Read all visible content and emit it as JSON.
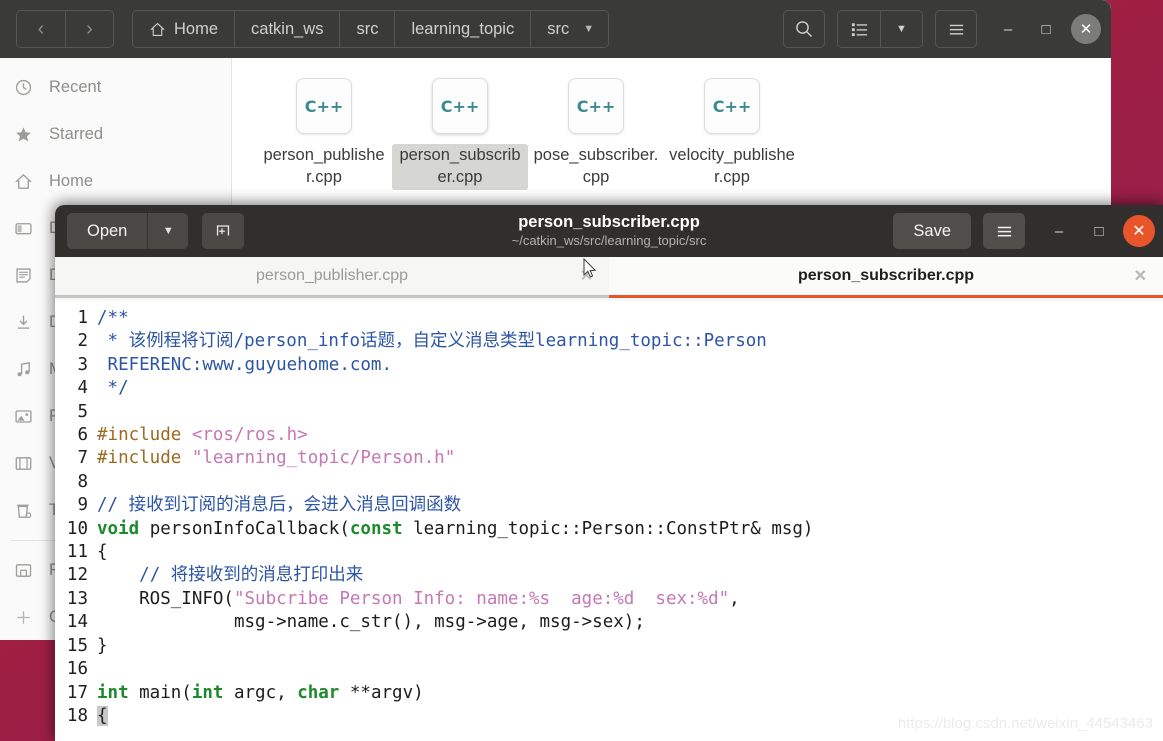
{
  "file_manager": {
    "nav": {
      "back_label": "‹",
      "forward_label": "›"
    },
    "breadcrumbs": [
      {
        "label": "Home",
        "icon": "home-icon"
      },
      {
        "label": "catkin_ws",
        "icon": ""
      },
      {
        "label": "src",
        "icon": ""
      },
      {
        "label": "learning_topic",
        "icon": ""
      },
      {
        "label": "src",
        "icon": ""
      }
    ],
    "toolbar": {
      "search_icon": "search-icon",
      "view_list_icon": "list-view-icon",
      "view_caret_icon": "chevron-down-icon",
      "menu_icon": "hamburger-menu-icon",
      "minimize_label": "–",
      "maximize_label": "□",
      "close_label": "✕"
    },
    "places": [
      {
        "label": "Recent",
        "icon": "clock-icon"
      },
      {
        "label": "Starred",
        "icon": "star-icon"
      },
      {
        "label": "Home",
        "icon": "home-icon"
      },
      {
        "label": "Desktop",
        "icon": "desktop-icon"
      },
      {
        "label": "Documents",
        "icon": "documents-icon"
      },
      {
        "label": "Downloads",
        "icon": "downloads-icon"
      },
      {
        "label": "Music",
        "icon": "music-icon"
      },
      {
        "label": "Pictures",
        "icon": "pictures-icon"
      },
      {
        "label": "Videos",
        "icon": "videos-icon"
      },
      {
        "label": "Trash",
        "icon": "trash-icon"
      },
      {
        "label": "Floppy Disk",
        "icon": "floppy-icon"
      },
      {
        "label": "Other Locations",
        "icon": "plus-icon"
      }
    ],
    "files": [
      {
        "name": "person_publisher.cpp",
        "type": "C++",
        "selected": false
      },
      {
        "name": "person_subscriber.cpp",
        "type": "C++",
        "selected": true
      },
      {
        "name": "pose_subscriber.cpp",
        "type": "C++",
        "selected": false
      },
      {
        "name": "velocity_publisher.cpp",
        "type": "C++",
        "selected": false
      }
    ]
  },
  "editor": {
    "open_label": "Open",
    "open_caret_icon": "chevron-down-icon",
    "new_tab_icon": "new-tab-icon",
    "title": "person_subscriber.cpp",
    "subtitle": "~/catkin_ws/src/learning_topic/src",
    "save_label": "Save",
    "menu_icon": "hamburger-menu-icon",
    "minimize_label": "–",
    "maximize_label": "□",
    "close_label": "✕",
    "tabs": [
      {
        "label": "person_publisher.cpp",
        "active": false,
        "close_label": "✕"
      },
      {
        "label": "person_subscriber.cpp",
        "active": true,
        "close_label": "✕"
      }
    ],
    "code_lines": [
      {
        "n": "1",
        "segments": [
          {
            "t": "/**",
            "c": "c-com"
          }
        ]
      },
      {
        "n": "2",
        "segments": [
          {
            "t": " * 该例程将订阅/person_info话题，自定义消息类型learning_topic::Person",
            "c": "c-com"
          }
        ]
      },
      {
        "n": "3",
        "segments": [
          {
            "t": " REFERENC:www.guyuehome.com.",
            "c": "c-com"
          }
        ]
      },
      {
        "n": "4",
        "segments": [
          {
            "t": " */",
            "c": "c-com"
          }
        ]
      },
      {
        "n": "5",
        "segments": [
          {
            "t": "",
            "c": ""
          }
        ]
      },
      {
        "n": "6",
        "segments": [
          {
            "t": "#include ",
            "c": "c-pre"
          },
          {
            "t": "<ros/ros.h>",
            "c": "c-str"
          }
        ]
      },
      {
        "n": "7",
        "segments": [
          {
            "t": "#include ",
            "c": "c-pre"
          },
          {
            "t": "\"learning_topic/Person.h\"",
            "c": "c-str"
          }
        ]
      },
      {
        "n": "8",
        "segments": [
          {
            "t": "",
            "c": ""
          }
        ]
      },
      {
        "n": "9",
        "segments": [
          {
            "t": "// 接收到订阅的消息后，会进入消息回调函数",
            "c": "c-com"
          }
        ]
      },
      {
        "n": "10",
        "segments": [
          {
            "t": "void",
            "c": "c-kw"
          },
          {
            "t": " personInfoCallback(",
            "c": ""
          },
          {
            "t": "const",
            "c": "c-kw"
          },
          {
            "t": " learning_topic::Person::ConstPtr& msg)",
            "c": ""
          }
        ]
      },
      {
        "n": "11",
        "segments": [
          {
            "t": "{",
            "c": ""
          }
        ]
      },
      {
        "n": "12",
        "segments": [
          {
            "t": "    ",
            "c": ""
          },
          {
            "t": "// 将接收到的消息打印出来",
            "c": "c-com"
          }
        ]
      },
      {
        "n": "13",
        "segments": [
          {
            "t": "    ROS_INFO(",
            "c": ""
          },
          {
            "t": "\"Subcribe Person Info: name:%s  age:%d  sex:%d\"",
            "c": "c-str"
          },
          {
            "t": ",",
            "c": ""
          }
        ]
      },
      {
        "n": "14",
        "segments": [
          {
            "t": "             msg->name.c_str(), msg->age, msg->sex);",
            "c": ""
          }
        ]
      },
      {
        "n": "15",
        "segments": [
          {
            "t": "}",
            "c": ""
          }
        ]
      },
      {
        "n": "16",
        "segments": [
          {
            "t": "",
            "c": ""
          }
        ]
      },
      {
        "n": "17",
        "segments": [
          {
            "t": "int",
            "c": "c-kw"
          },
          {
            "t": " main(",
            "c": ""
          },
          {
            "t": "int",
            "c": "c-kw"
          },
          {
            "t": " argc, ",
            "c": ""
          },
          {
            "t": "char",
            "c": "c-kw"
          },
          {
            "t": " **argv)",
            "c": ""
          }
        ]
      },
      {
        "n": "18",
        "segments": [
          {
            "t": "{",
            "c": "c-sel"
          }
        ]
      }
    ]
  },
  "watermark": "https://blog.csdn.net/weixin_44543463",
  "colors": {
    "ubuntu_orange": "#e8552a",
    "header_dark": "#3a3a38",
    "gedit_header_dark": "#302f2d",
    "comment_blue": "#2d55a5",
    "string_pink": "#c478b4",
    "keyword_green": "#1d8b2b",
    "preproc_brown": "#9a6b1f",
    "cpp_icon_teal": "#3a8a8f"
  }
}
